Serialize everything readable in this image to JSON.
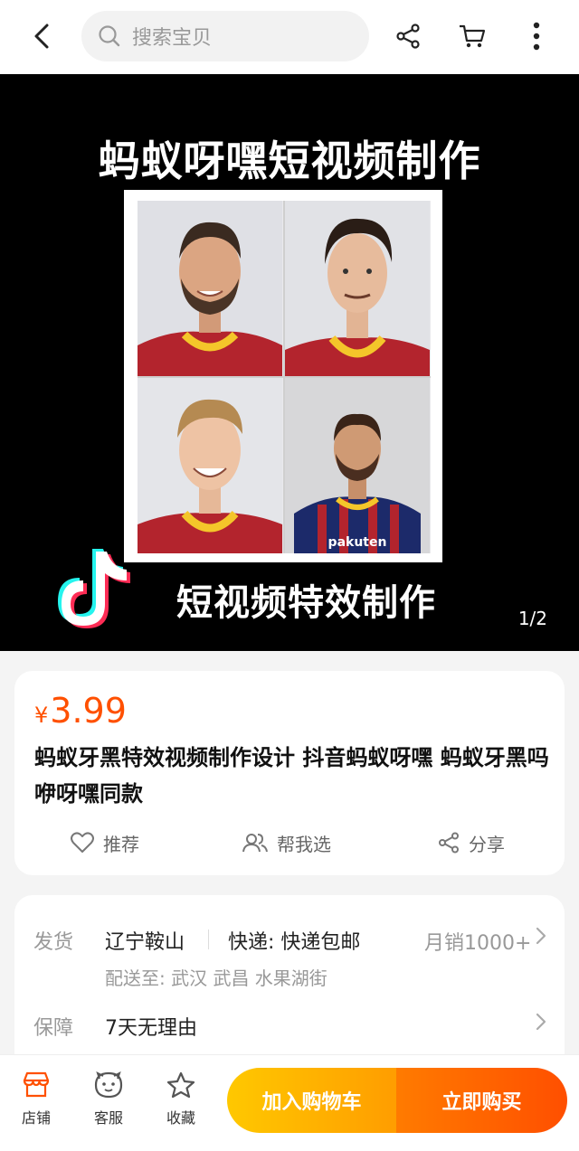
{
  "search": {
    "placeholder": "搜索宝贝"
  },
  "hero": {
    "title": "蚂蚁呀嘿短视频制作",
    "subtitle": "短视频特效制作",
    "counter": "1/2",
    "overlay_text": "pakuten"
  },
  "product": {
    "currency": "¥",
    "price": "3.99",
    "title": "蚂蚁牙黑特效视频制作设计 抖音蚂蚁呀嘿 蚂蚁牙黑吗咿呀嘿同款",
    "actions": {
      "recommend": "推荐",
      "help_choose": "帮我选",
      "share": "分享"
    }
  },
  "shipping": {
    "label": "发货",
    "origin": "辽宁鞍山",
    "express": "快递: 快递包邮",
    "monthly_sales": "月销1000+",
    "deliver_to": "配送至: 武汉 武昌 水果湖街"
  },
  "guarantee": {
    "label": "保障",
    "text": "7天无理由"
  },
  "bottom": {
    "store": "店铺",
    "service": "客服",
    "favorite": "收藏",
    "add_to_cart": "加入购物车",
    "buy_now": "立即购买"
  },
  "colors": {
    "accent": "#ff5000",
    "cart_btn": "#ffb400",
    "buy_btn": "#ff6000"
  }
}
